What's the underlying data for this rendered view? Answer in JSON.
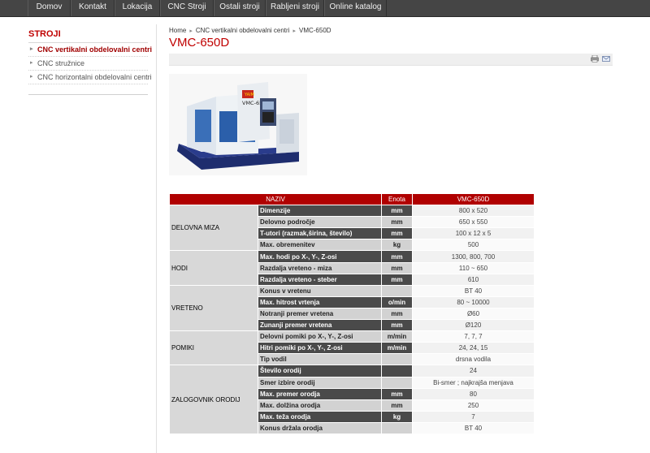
{
  "nav": {
    "items": [
      {
        "label": "Domov",
        "width": 53
      },
      {
        "label": "Kontakt",
        "width": 54
      },
      {
        "label": "Lokacija",
        "width": 56
      },
      {
        "label": "CNC Stroji",
        "width": 66
      },
      {
        "label": "Ostali stroji",
        "width": 64
      },
      {
        "label": "Rabljeni stroji",
        "width": 72
      },
      {
        "label": "Online katalog",
        "width": 77
      }
    ]
  },
  "sidebar": {
    "title": "STROJI",
    "items": [
      {
        "label": "CNC vertikalni obdelovalni centri",
        "active": true
      },
      {
        "label": "CNC stružnice",
        "active": false
      },
      {
        "label": "CNC horizontalni obdelovalni centri",
        "active": false
      }
    ]
  },
  "breadcrumb": {
    "items": [
      "Home",
      "CNC vertikalni obdelovalni centri",
      "VMC-650D"
    ]
  },
  "page": {
    "title": "VMC-650D",
    "image_label": "VMC-650D",
    "icons": {
      "print": "print-icon",
      "email": "email-icon"
    }
  },
  "table": {
    "headers": [
      "NAZIV",
      "Enota",
      "VMC-650D"
    ],
    "groups": [
      {
        "name": "DELOVNA MIZA",
        "rows": [
          [
            "Dimenzije",
            "mm",
            "800 x 520"
          ],
          [
            "Delovno področje",
            "mm",
            "650 x 550"
          ],
          [
            "T-utori (razmak,širina, število)",
            "mm",
            "100 x 12 x 5"
          ],
          [
            "Max. obremenitev",
            "kg",
            "500"
          ]
        ]
      },
      {
        "name": "HODI",
        "rows": [
          [
            "Max. hodi po X-, Y-, Z-osi",
            "mm",
            "1300, 800, 700"
          ],
          [
            "Razdalja vreteno - miza",
            "mm",
            "110 ~ 650"
          ],
          [
            "Razdalja vreteno - steber",
            "mm",
            "610"
          ]
        ]
      },
      {
        "name": "VRETENO",
        "rows": [
          [
            "Konus v vretenu",
            "",
            "BT 40"
          ],
          [
            "Max. hitrost vrtenja",
            "o/min",
            "80 ~ 10000"
          ],
          [
            "Notranji premer vretena",
            "mm",
            "Ø60"
          ],
          [
            "Zunanji premer vretena",
            "mm",
            "Ø120"
          ]
        ]
      },
      {
        "name": "POMIKI",
        "rows": [
          [
            "Delovni pomiki po X-, Y-, Z-osi",
            "m/min",
            "7, 7, 7"
          ],
          [
            "Hitri pomiki po X-, Y-, Z-osi",
            "m/min",
            "24, 24, 15"
          ],
          [
            "Tip vodil",
            "",
            "drsna vodila"
          ]
        ]
      },
      {
        "name": "ZALOGOVNIK ORODIJ",
        "rows": [
          [
            "Število orodij",
            "",
            "24"
          ],
          [
            "Smer izbire orodij",
            "",
            "Bi-smer ; najkrajša menjava"
          ],
          [
            "Max. premer orodja",
            "mm",
            "80"
          ],
          [
            "Max. dolžina orodja",
            "mm",
            "250"
          ],
          [
            "Max. teža orodja",
            "kg",
            "7"
          ],
          [
            "Konus držala orodja",
            "",
            "BT 40"
          ]
        ]
      }
    ]
  },
  "colors": {
    "accent": "#c00000",
    "nav_bg": "#454545",
    "table_dark": "#4a4a4a",
    "table_light": "#d2d2d2"
  }
}
